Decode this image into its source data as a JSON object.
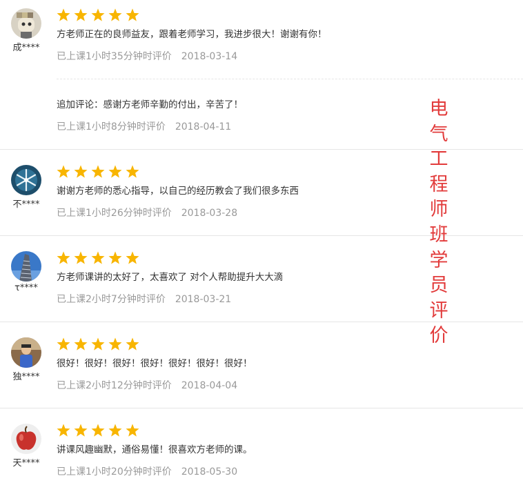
{
  "rating_max": 5,
  "star_color": "#f8b500",
  "reviews": [
    {
      "user": "成****",
      "avatar_icon": "cartoon-avatar",
      "rating": 5,
      "comment": "方老师正在的良师益友，跟着老师学习，我进步很大！谢谢有你！",
      "duration": "已上课1小时35分钟时评价",
      "date": "2018-03-14",
      "followup": {
        "comment": "追加评论：感谢方老师辛勤的付出，辛苦了！",
        "duration": "已上课1小时8分钟时评价",
        "date": "2018-04-11"
      }
    },
    {
      "user": "不****",
      "avatar_icon": "snowflake-avatar",
      "rating": 5,
      "comment": "谢谢方老师的悉心指导，以自己的经历教会了我们很多东西",
      "duration": "已上课1小时26分钟时评价",
      "date": "2018-03-28"
    },
    {
      "user": "τ****",
      "avatar_icon": "building-avatar",
      "rating": 5,
      "comment": "方老师课讲的太好了，太喜欢了 对个人帮助提升大大滴",
      "duration": "已上课2小时7分钟时评价",
      "date": "2018-03-21"
    },
    {
      "user": "独****",
      "avatar_icon": "child-photo-avatar",
      "rating": 5,
      "comment": "很好！很好！很好！很好！很好！很好！很好！",
      "duration": "已上课2小时12分钟时评价",
      "date": "2018-04-04"
    },
    {
      "user": "天****",
      "avatar_icon": "apple-avatar",
      "rating": 5,
      "comment": "讲课风趣幽默，通俗易懂！很喜欢方老师的课。",
      "duration": "已上课1小时20分钟时评价",
      "date": "2018-05-30"
    }
  ],
  "watermark": "电气工程师班学员评价",
  "watermark_color": "#e23b3b"
}
